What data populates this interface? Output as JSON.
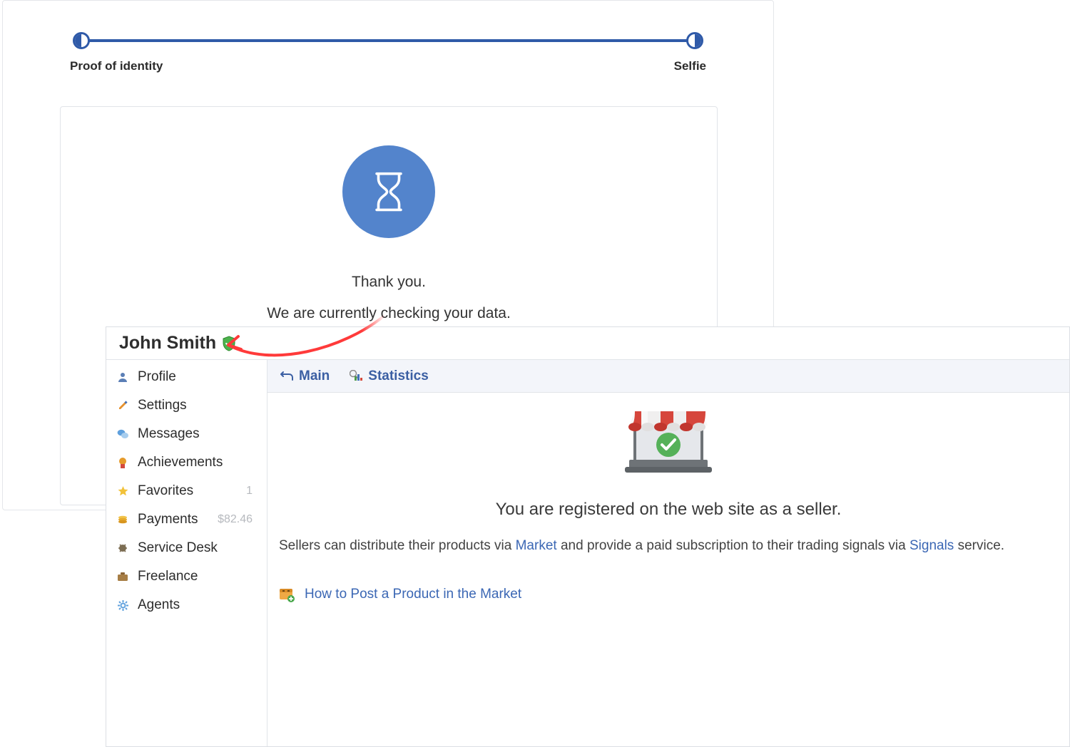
{
  "progress": {
    "step1": "Proof of identity",
    "step2": "Selfie"
  },
  "verify_card": {
    "title": "Thank you.",
    "subtitle": "We are currently checking your data."
  },
  "profile": {
    "username": "John Smith",
    "sidebar": {
      "profile": {
        "label": "Profile"
      },
      "settings": {
        "label": "Settings"
      },
      "messages": {
        "label": "Messages"
      },
      "achievements": {
        "label": "Achievements"
      },
      "favorites": {
        "label": "Favorites",
        "count": "1"
      },
      "payments": {
        "label": "Payments",
        "amount": "$82.46"
      },
      "servicedesk": {
        "label": "Service Desk"
      },
      "freelance": {
        "label": "Freelance"
      },
      "agents": {
        "label": "Agents"
      }
    },
    "toolbar": {
      "main": "Main",
      "stats": "Statistics"
    },
    "content": {
      "seller_heading": "You are registered on the web site as a seller.",
      "seller_desc_1": "Sellers can distribute their products via ",
      "seller_desc_link1": "Market",
      "seller_desc_2": " and provide a paid subscription to their trading signals via ",
      "seller_desc_link2": "Signals",
      "seller_desc_3": " service.",
      "howto_label": "How to Post a Product in the Market"
    }
  }
}
